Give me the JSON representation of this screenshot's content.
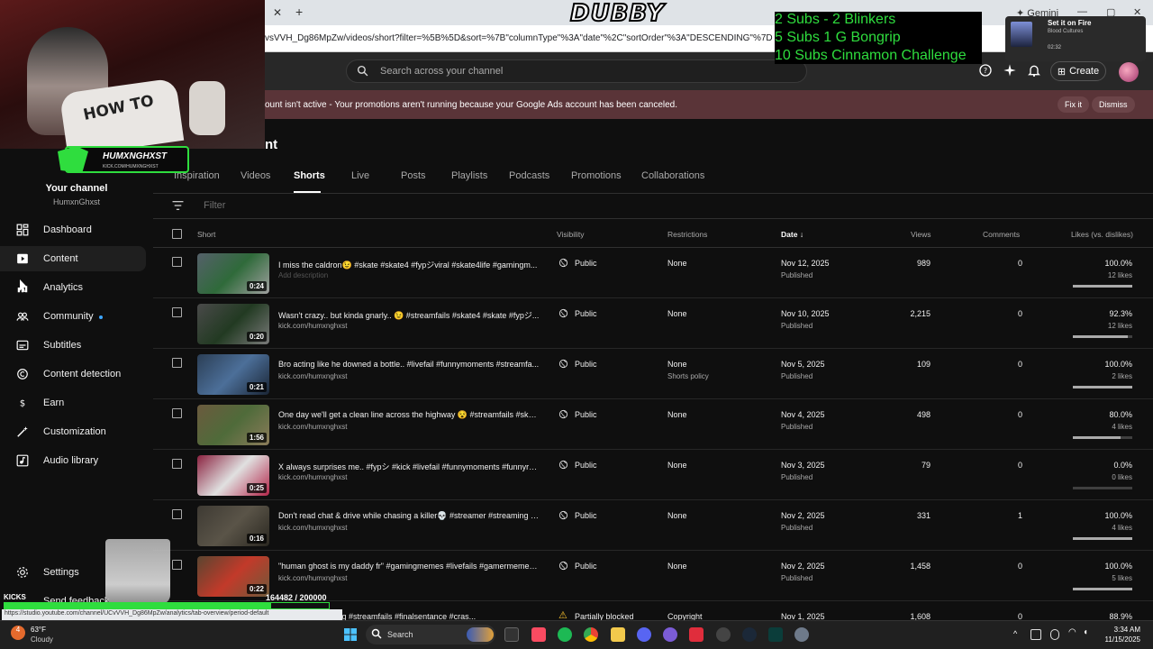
{
  "browser": {
    "url": "vsVVH_Dg86MpZw/videos/short?filter=%5B%5D&sort=%7B\"columnType\"%3A\"date\"%2C\"sortOrder\"%3A\"DESCENDING\"%7D",
    "gemini_label": "Gemini",
    "status_url": "https://studio.youtube.com/channel/UCvVVH_Dg86MpZw/analytics/tab-overview/period-default"
  },
  "header": {
    "search_placeholder": "Search across your channel",
    "create_label": "Create"
  },
  "banner": {
    "text": "ount isn't active - Your promotions aren't running because your Google Ads account has been canceled.",
    "fix_label": "Fix it",
    "dismiss_label": "Dismiss"
  },
  "sidebar": {
    "channel_title": "Your channel",
    "channel_handle": "HumxnGhxst",
    "items": [
      {
        "label": "Dashboard",
        "icon": "dashboard-icon"
      },
      {
        "label": "Content",
        "icon": "content-icon"
      },
      {
        "label": "Analytics",
        "icon": "analytics-icon"
      },
      {
        "label": "Community",
        "icon": "community-icon"
      },
      {
        "label": "Subtitles",
        "icon": "subtitles-icon"
      },
      {
        "label": "Content detection",
        "icon": "copyright-icon"
      },
      {
        "label": "Earn",
        "icon": "dollar-icon"
      },
      {
        "label": "Customization",
        "icon": "wand-icon"
      },
      {
        "label": "Audio library",
        "icon": "audio-library-icon"
      }
    ],
    "settings_label": "Settings",
    "feedback_label": "Send feedback"
  },
  "page": {
    "title": "nt",
    "tabs": [
      "Inspiration",
      "Videos",
      "Shorts",
      "Live",
      "Posts",
      "Playlists",
      "Podcasts",
      "Promotions",
      "Collaborations"
    ],
    "active_tab": "Shorts",
    "filter_placeholder": "Filter"
  },
  "table": {
    "columns": {
      "short": "Short",
      "visibility": "Visibility",
      "restrictions": "Restrictions",
      "date": "Date",
      "views": "Views",
      "comments": "Comments",
      "likes": "Likes (vs. dislikes)"
    },
    "rows": [
      {
        "title": "I miss the caldron😉 #skate #skate4 #fypジviral #skate4life #gamingm...",
        "sub": "Add description",
        "duration": "0:24",
        "visibility": "Public",
        "restriction": "None",
        "restriction2": "",
        "date": "Nov 12, 2025",
        "status": "Published",
        "views": "989",
        "comments": "0",
        "likes_pct": "100.0%",
        "likes": "12 likes",
        "ratio": 1.0
      },
      {
        "title": "Wasn't crazy.. but kinda gnarly.. 😉 #streamfails #skate4 #skate #fypジ...",
        "sub": "kick.com/humxnghxst",
        "duration": "0:20",
        "visibility": "Public",
        "restriction": "None",
        "restriction2": "",
        "date": "Nov 10, 2025",
        "status": "Published",
        "views": "2,215",
        "comments": "0",
        "likes_pct": "92.3%",
        "likes": "12 likes",
        "ratio": 0.923
      },
      {
        "title": "Bro acting like he downed a bottle.. #livefail #funnymoments #streamfa...",
        "sub": "kick.com/humxnghxst",
        "duration": "0:21",
        "visibility": "Public",
        "restriction": "None",
        "restriction2": "Shorts policy",
        "date": "Nov 5, 2025",
        "status": "Published",
        "views": "109",
        "comments": "0",
        "likes_pct": "100.0%",
        "likes": "2 likes",
        "ratio": 1.0
      },
      {
        "title": "One day we'll get a clean line across the highway 😵 #streamfails #skat...",
        "sub": "kick.com/humxnghxst",
        "duration": "1:56",
        "visibility": "Public",
        "restriction": "None",
        "restriction2": "",
        "date": "Nov 4, 2025",
        "status": "Published",
        "views": "498",
        "comments": "0",
        "likes_pct": "80.0%",
        "likes": "4 likes",
        "ratio": 0.8
      },
      {
        "title": "X always surprises me.. #fypシ #kick #livefail #funnymoments #funnyre...",
        "sub": "kick.com/humxnghxst",
        "duration": "0:25",
        "visibility": "Public",
        "restriction": "None",
        "restriction2": "",
        "date": "Nov 3, 2025",
        "status": "Published",
        "views": "79",
        "comments": "0",
        "likes_pct": "0.0%",
        "likes": "0 likes",
        "ratio": 0.0
      },
      {
        "title": "Don't read chat & drive while chasing a killer💀 #streamer #streaming #...",
        "sub": "kick.com/humxnghxst",
        "duration": "0:16",
        "visibility": "Public",
        "restriction": "None",
        "restriction2": "",
        "date": "Nov 2, 2025",
        "status": "Published",
        "views": "331",
        "comments": "1",
        "likes_pct": "100.0%",
        "likes": "4 likes",
        "ratio": 1.0
      },
      {
        "title": "\"human ghost is my daddy fr\" #gamingmemes #livefails #gamermemes...",
        "sub": "kick.com/humxnghxst",
        "duration": "0:22",
        "visibility": "Public",
        "restriction": "None",
        "restriction2": "",
        "date": "Nov 2, 2025",
        "status": "Published",
        "views": "1,458",
        "comments": "0",
        "likes_pct": "100.0%",
        "likes": "5 likes",
        "ratio": 1.0
      },
      {
        "title": "reamer #streaming #streamfails #finalsentance #cras...",
        "sub": "",
        "duration": "",
        "visibility": "Partially blocked",
        "restriction": "Copyright",
        "restriction2": "",
        "date": "Nov 1, 2025",
        "status": "",
        "views": "1,608",
        "comments": "0",
        "likes_pct": "88.9%",
        "likes": "",
        "ratio": 0.889
      }
    ]
  },
  "overlay": {
    "title": "DUBBY",
    "goals": [
      "2 Subs - 2 Blinkers",
      "5 Subs 1 G Bongrip",
      "10 Subs Cinnamon Challenge"
    ],
    "streamer_name": "HUMXNGHXST",
    "streamer_sub": "KICK.COM/HUMXNGHXST",
    "shirt_text": "HOW TO",
    "music_title": "Set it on Fire",
    "music_artist": "Blood Cultures",
    "music_time": "02:32",
    "kicks_label": "KICKS",
    "kicks_progress": "164482 / 200000",
    "kicks_value": 164482,
    "kicks_goal": 200000
  },
  "taskbar": {
    "temp": "63°F",
    "condition": "Cloudy",
    "search_label": "Search",
    "time": "3:34 AM",
    "date": "11/15/2025",
    "notification_count": "4"
  }
}
